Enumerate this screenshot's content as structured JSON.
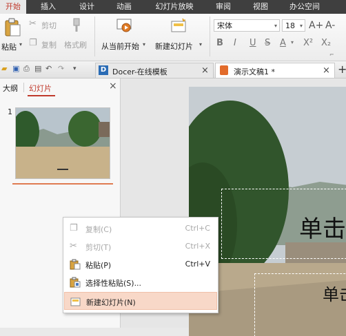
{
  "menubar": {
    "tabs": [
      {
        "label": "开始",
        "active": true
      },
      {
        "label": "插入"
      },
      {
        "label": "设计"
      },
      {
        "label": "动画"
      },
      {
        "label": "幻灯片放映"
      },
      {
        "label": "审阅"
      },
      {
        "label": "视图"
      },
      {
        "label": "办公空间"
      }
    ]
  },
  "ribbon": {
    "paste_label": "粘贴",
    "cut_label": "剪切",
    "copy_label": "复制",
    "format_painter_label": "格式刷",
    "from_current_label": "从当前开始",
    "new_slide_label": "新建幻灯片",
    "font_name": "宋体",
    "font_size": "18",
    "grow_font": "A+",
    "shrink_font": "A-",
    "bold": "B",
    "italic": "I",
    "underline": "U",
    "strike": "S",
    "font_color": "A",
    "superscript": "X²",
    "subscript": "X₂"
  },
  "doc_tabs": [
    {
      "label": "Docer-在线模板",
      "active": false
    },
    {
      "label": "演示文稿1 *",
      "active": true
    }
  ],
  "left_pane": {
    "tabs": [
      {
        "label": "大纲"
      },
      {
        "label": "幻灯片",
        "active": true
      }
    ],
    "slide_number": "1"
  },
  "slide": {
    "title_text": "单击",
    "subtitle_text": "单击"
  },
  "context_menu": {
    "items": [
      {
        "label": "复制(C)",
        "shortcut": "Ctrl+C",
        "enabled": false,
        "icon": "copy-icon"
      },
      {
        "label": "剪切(T)",
        "shortcut": "Ctrl+X",
        "enabled": false,
        "icon": "scissors-icon"
      },
      {
        "label": "粘贴(P)",
        "shortcut": "Ctrl+V",
        "enabled": true,
        "icon": "paste-icon"
      },
      {
        "label": "选择性粘贴(S)...",
        "shortcut": "",
        "enabled": true,
        "icon": "paste-special-icon"
      },
      {
        "label": "新建幻灯片(N)",
        "shortcut": "",
        "enabled": true,
        "highlighted": true,
        "icon": "new-slide-icon"
      }
    ]
  },
  "colors": {
    "accent": "#c0392b",
    "menubar_bg": "#3f3f3f",
    "highlight": "#f8d8c8"
  }
}
